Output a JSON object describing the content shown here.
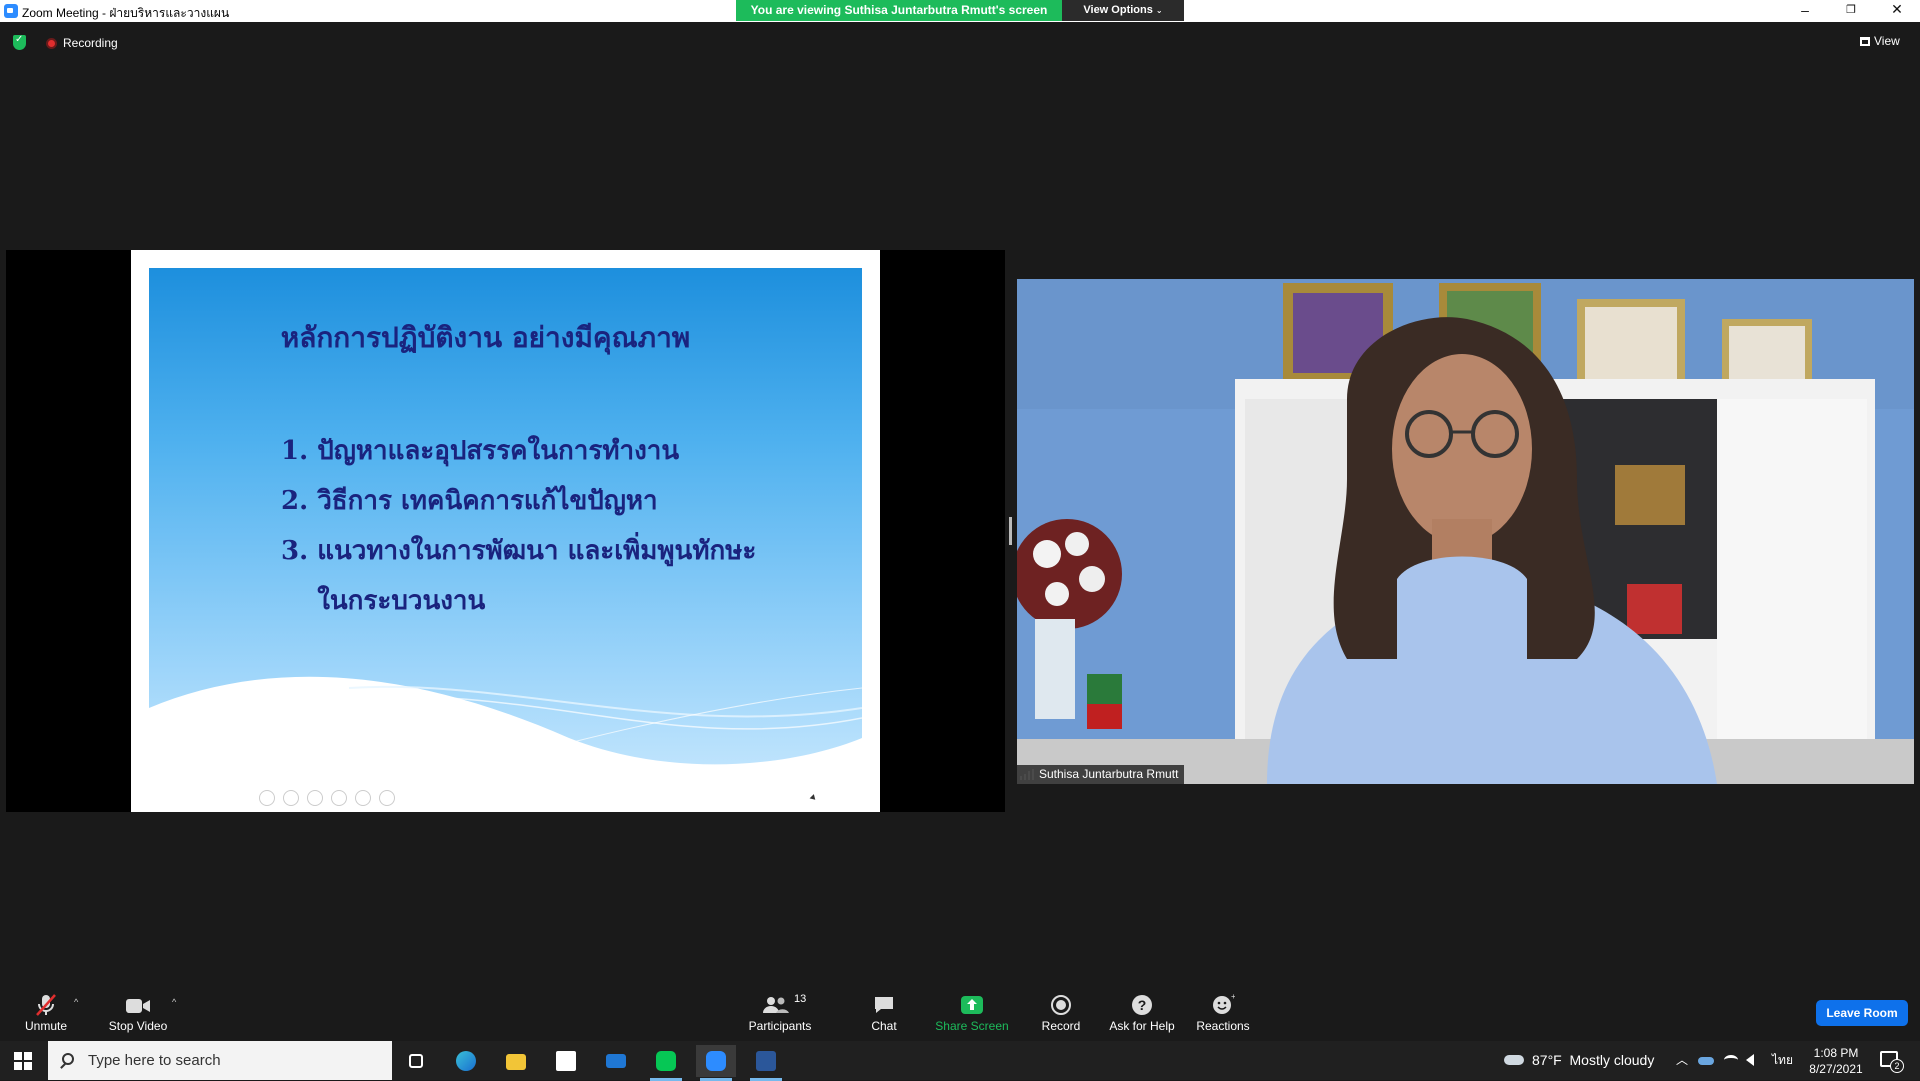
{
  "window": {
    "title": "Zoom Meeting - ฝ่ายบริหารและวางแผน",
    "viewing_banner": "You are viewing Suthisa  Juntarbutra Rmutt's screen",
    "view_options": "View Options",
    "minimize": "–",
    "restore": "❐",
    "close": "✕"
  },
  "meeting": {
    "recording_label": "Recording",
    "view_label": "View"
  },
  "slide": {
    "title": "หลักการปฏิบัติงาน อย่างมีคุณภาพ",
    "items": [
      "1. ปัญหาและอุปสรรคในการทำงาน",
      "2. วิธีการ เทคนิคการแก้ไขปัญหา",
      "3. แนวทางในการพัฒนา และเพิ่มพูนทักษะ",
      "    ในกระบวนงาน"
    ]
  },
  "participant": {
    "name": "Suthisa  Juntarbutra Rmutt"
  },
  "toolbar": {
    "unmute": "Unmute",
    "stop_video": "Stop Video",
    "participants": "Participants",
    "participants_count": "13",
    "chat": "Chat",
    "share_screen": "Share Screen",
    "record": "Record",
    "ask_for_help": "Ask for Help",
    "reactions": "Reactions",
    "leave_room": "Leave Room"
  },
  "taskbar": {
    "search_placeholder": "Type here to search",
    "weather_temp": "87°F",
    "weather_desc": "Mostly cloudy",
    "language": "ไทย",
    "time": "1:08 PM",
    "date": "8/27/2021",
    "notification_count": "2"
  },
  "colors": {
    "accent_green": "#1dbb5b",
    "leave_blue": "#0e71eb",
    "recording_red": "#e02e2e"
  }
}
